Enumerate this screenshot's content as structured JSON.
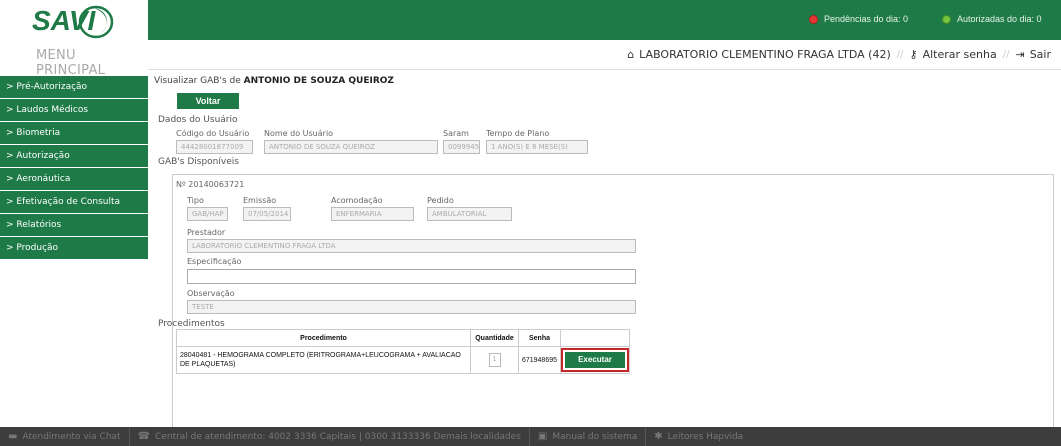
{
  "brand": {
    "logo_text": "SAVI",
    "menu_title": "MENU PRINCIPAL",
    "primary_color": "#1e7a47"
  },
  "topbar": {
    "pendencias": "Pendências do dia: 0",
    "autorizadas": "Autorizadas do dia: 0"
  },
  "userbar": {
    "provider": "LABORATORIO CLEMENTINO FRAGA LTDA (42)",
    "alterar_senha": "Alterar senha",
    "sair": "Sair"
  },
  "sidebar": {
    "items": [
      {
        "label": "> Pré-Autorização"
      },
      {
        "label": "> Laudos Médicos"
      },
      {
        "label": "> Biometria"
      },
      {
        "label": "> Autorização"
      },
      {
        "label": "> Aeronáutica"
      },
      {
        "label": "> Efetivação de Consulta"
      },
      {
        "label": "> Relatórios"
      },
      {
        "label": "> Produção"
      }
    ]
  },
  "main": {
    "title_prefix": "Visualizar GAB's de ",
    "title_name": "ANTONIO DE SOUZA QUEIROZ",
    "voltar": "Voltar",
    "dados_usuario": "Dados do Usuário",
    "codigo_label": "Código do Usuário",
    "codigo_value": "44428001877009",
    "nome_label": "Nome do Usuário",
    "nome_value": "ANTONIO DE SOUZA QUEIROZ",
    "saram_label": "Saram",
    "saram_value": "0099945",
    "tempo_label": "Tempo de Plano",
    "tempo_value": "1 ANO(S) E 8 MESE(S)",
    "gabs_disponiveis": "GAB's Disponíveis"
  },
  "gab": {
    "numero": "Nº 20140063721",
    "tipo_label": "Tipo",
    "tipo_value": "GAB/HAP",
    "emissao_label": "Emissão",
    "emissao_value": "07/05/2014",
    "acomodacao_label": "Acomodação",
    "acomodacao_value": "ENFERMARIA",
    "pedido_label": "Pedido",
    "pedido_value": "AMBULATORIAL",
    "prestador_label": "Prestador",
    "prestador_value": "LABORATORIO CLEMENTINO FRAGA LTDA",
    "especificacao_label": "Especificação",
    "especificacao_value": "",
    "observacao_label": "Observação",
    "observacao_value": "TESTE",
    "procedimentos_label": "Procedimentos"
  },
  "procedures": {
    "headers": [
      "Procedimento",
      "Quantidade",
      "Senha",
      ""
    ],
    "rows": [
      {
        "procedimento": "28040481 - HEMOGRAMA COMPLETO (ERITROGRAMA+LEUCOGRAMA + AVALIACAO DE PLAQUETAS)",
        "quantidade": "1",
        "senha": "671948695",
        "action": "Executar"
      }
    ]
  },
  "footer": {
    "chat": "Atendimento via Chat",
    "central": "Central de atendimento: 4002 3336 Capitais | 0300 3133336 Demais localidades",
    "manual": "Manual do sistema",
    "leitores": "Leitores Hapvida"
  }
}
